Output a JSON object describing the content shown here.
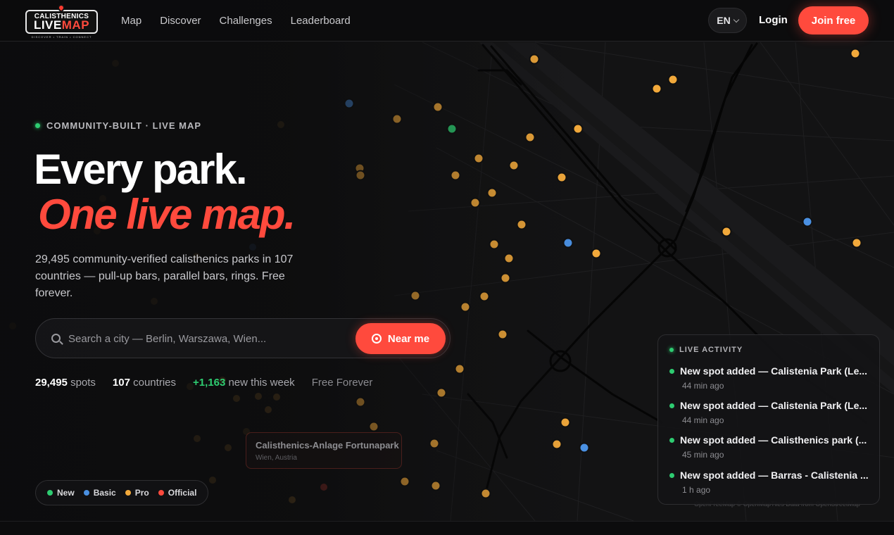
{
  "brand": {
    "logo_top": "CALISTHENICS",
    "logo_word_1": "LIVE",
    "logo_word_2": "MAP",
    "logo_tagline": "DISCOVER • TRAIN • CONNECT"
  },
  "nav": {
    "items": [
      "Map",
      "Discover",
      "Challenges",
      "Leaderboard"
    ],
    "language": "EN",
    "login": "Login",
    "join": "Join free"
  },
  "hero": {
    "eyebrow": "COMMUNITY-BUILT · LIVE MAP",
    "headline_1": "Every park.",
    "headline_2": "One live map.",
    "lead": "29,495 community-verified calisthenics parks in 107 countries — pull-up bars, parallel bars, rings. Free forever."
  },
  "search": {
    "placeholder": "Search a city — Berlin, Warszawa, Wien...",
    "near_me": "Near me"
  },
  "stats": {
    "spots_value": "29,495",
    "spots_label": "spots",
    "countries_value": "107",
    "countries_label": "countries",
    "new_value": "+1,163",
    "new_label": "new this week",
    "free": "Free Forever"
  },
  "legend": [
    {
      "label": "New",
      "color": "#2ecc71"
    },
    {
      "label": "Basic",
      "color": "#4a90e2"
    },
    {
      "label": "Pro",
      "color": "#f2a93b"
    },
    {
      "label": "Official",
      "color": "#ff4a3d"
    }
  ],
  "map_tooltip": {
    "name": "Calisthenics-Anlage Fortunapark",
    "location": "Wien, Austria"
  },
  "activity": {
    "title": "LIVE ACTIVITY",
    "items": [
      {
        "text": "New spot added — Calistenia Park (Le...",
        "time": "44 min ago"
      },
      {
        "text": "New spot added — Calistenia Park (Le...",
        "time": "44 min ago"
      },
      {
        "text": "New spot added — Calisthenics park (...",
        "time": "45 min ago"
      },
      {
        "text": "New spot added — Barras - Calistenia ...",
        "time": "1 h ago"
      }
    ]
  },
  "attribution": "OpenFreeMap © OpenMapTiles Data from OpenStreetMap",
  "colors": {
    "accent": "#ff4a3d",
    "new": "#2ecc71",
    "basic": "#4a90e2",
    "pro": "#f2a93b"
  }
}
